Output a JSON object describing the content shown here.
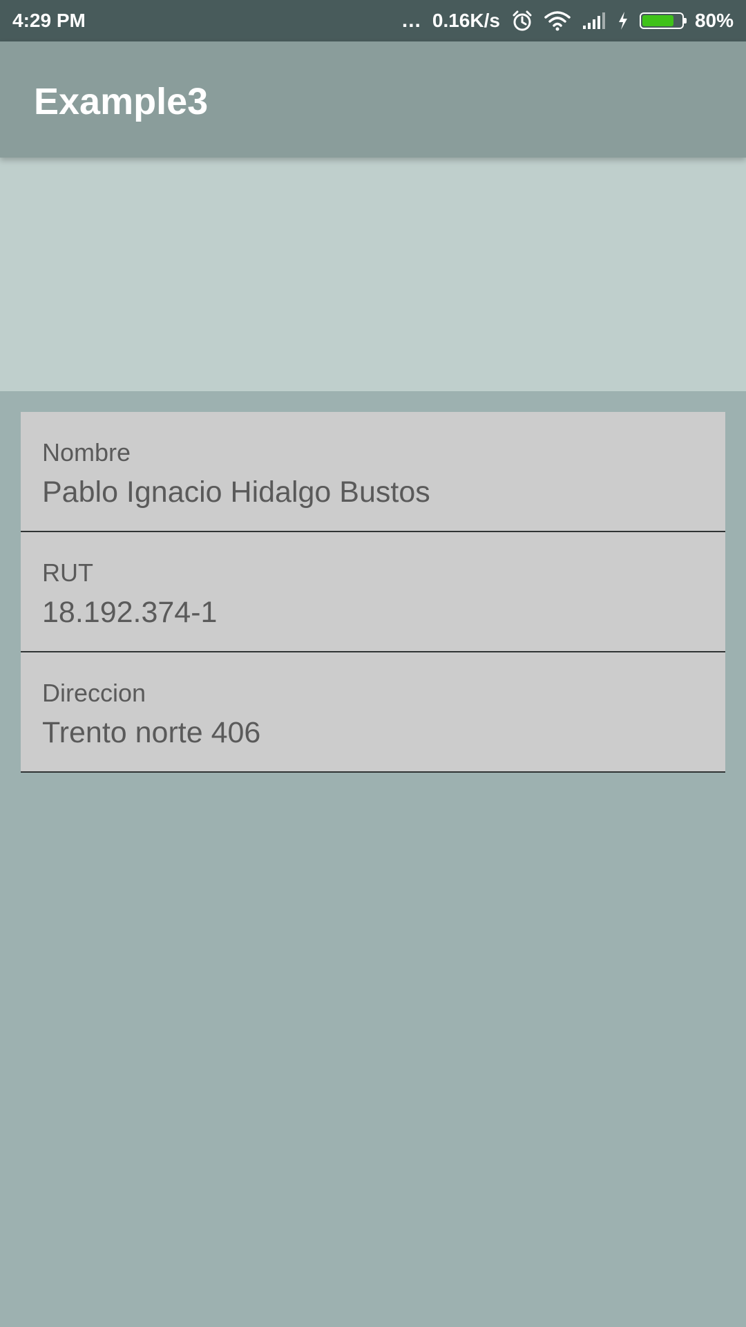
{
  "status_bar": {
    "time": "4:29 PM",
    "dots": "...",
    "net_speed": "0.16K/s",
    "battery_percent": "80%",
    "battery_level": 0.8,
    "battery_color": "#3fc21a",
    "icons": [
      "alarm-icon",
      "wifi-icon",
      "signal-icon",
      "charging-icon",
      "battery-icon"
    ]
  },
  "app_bar": {
    "title": "Example3",
    "color": "#8a9d9b"
  },
  "form": {
    "fields": [
      {
        "label": "Nombre",
        "value": "Pablo Ignacio Hidalgo Bustos"
      },
      {
        "label": "RUT",
        "value": "18.192.374-1"
      },
      {
        "label": "Direccion",
        "value": "Trento norte 406"
      }
    ]
  }
}
